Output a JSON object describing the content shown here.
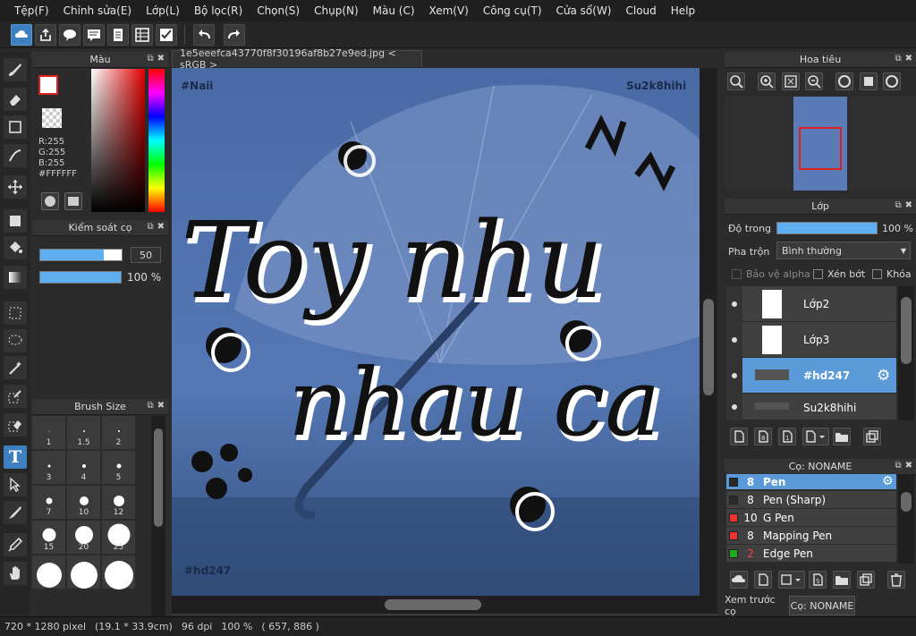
{
  "menu": [
    "Tệp(F)",
    "Chỉnh sửa(E)",
    "Lớp(L)",
    "Bộ lọc(R)",
    "Chọn(S)",
    "Chụp(N)",
    "Màu (C)",
    "Xem(V)",
    "Công cụ(T)",
    "Cửa sổ(W)",
    "Cloud",
    "Help"
  ],
  "color_panel": {
    "title": "Màu",
    "r": "R:255",
    "g": "G:255",
    "b": "B:255",
    "hex": "#FFFFFF"
  },
  "brush_control": {
    "title": "Kiểm soát cọ",
    "size_value": "50",
    "opacity_value": "100 %"
  },
  "brush_size_panel": {
    "title": "Brush Size",
    "sizes": [
      "1",
      "1.5",
      "2",
      "3",
      "4",
      "5",
      "7",
      "10",
      "12",
      "15",
      "20",
      "25"
    ]
  },
  "document": {
    "tab_label": "1e5eeefca43770f8f30196af8b27e9ed.jpg < sRGB >",
    "watermark_tl": "#Naii",
    "watermark_tr": "Su2k8hihi",
    "watermark_bl": "#hd247",
    "line1": "Toy nhu",
    "line2": "nhau ca"
  },
  "navigator": {
    "title": "Hoa tiêu"
  },
  "layer_panel": {
    "title": "Lớp",
    "opacity_label": "Độ trong",
    "opacity_value": "100 %",
    "blend_label": "Pha trộn",
    "blend_value": "Bình thường",
    "protect_alpha": "Bảo vệ alpha",
    "clipping": "Xén bớt",
    "lock": "Khóa",
    "layers": [
      {
        "name": "Lớp2"
      },
      {
        "name": "Lớp3"
      },
      {
        "name": "#hd247"
      },
      {
        "name": "Su2k8hihi"
      }
    ]
  },
  "brush_panel": {
    "title": "Cọ: NONAME",
    "brushes": [
      {
        "size": "8",
        "name": "Pen",
        "color": "#2a2a2a"
      },
      {
        "size": "8",
        "name": "Pen (Sharp)",
        "color": "#2a2a2a"
      },
      {
        "size": "10",
        "name": "G Pen",
        "color": "#ee3333"
      },
      {
        "size": "8",
        "name": "Mapping Pen",
        "color": "#ee3333"
      },
      {
        "size": "2",
        "name": "Edge Pen",
        "color": "#22aa22"
      }
    ],
    "tab_preview": "Xem trước cọ",
    "tab_brush": "Cọ: NONAME"
  },
  "status": {
    "size": "720 * 1280 pixel",
    "cm": "(19.1 * 33.9cm)",
    "dpi": "96 dpi",
    "zoom": "100 %",
    "coords": "( 657, 886 )"
  },
  "colors": {
    "accent": "#5a9ad8",
    "canvas_bg": "#4a6fa8"
  }
}
